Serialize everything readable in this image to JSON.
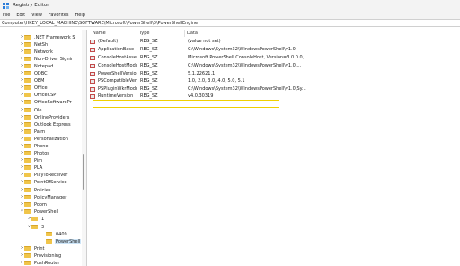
{
  "window": {
    "title": "Registry Editor"
  },
  "menu": [
    "File",
    "Edit",
    "View",
    "Favorites",
    "Help"
  ],
  "address": "Computer\\HKEY_LOCAL_MACHINE\\SOFTWARE\\Microsoft\\PowerShell\\3\\PowerShellEngine",
  "tree": [
    {
      "label": ".NET Framework S",
      "chevron": ">"
    },
    {
      "label": "NetSh",
      "chevron": ">"
    },
    {
      "label": "Network",
      "chevron": ">"
    },
    {
      "label": "Non-Driver Signir",
      "chevron": ">"
    },
    {
      "label": "Notepad",
      "chevron": ">"
    },
    {
      "label": "ODBC",
      "chevron": ">"
    },
    {
      "label": "OEM",
      "chevron": ">"
    },
    {
      "label": "Office",
      "chevron": ">"
    },
    {
      "label": "OfficeCSP",
      "chevron": ">"
    },
    {
      "label": "OfficeSoftwarePr",
      "chevron": ">"
    },
    {
      "label": "Ole",
      "chevron": ">"
    },
    {
      "label": "OnlineProviders",
      "chevron": ">"
    },
    {
      "label": "Outlook Express",
      "chevron": ">"
    },
    {
      "label": "Palm",
      "chevron": ">"
    },
    {
      "label": "Personalization",
      "chevron": ">"
    },
    {
      "label": "Phone",
      "chevron": ">"
    },
    {
      "label": "Photos",
      "chevron": ">"
    },
    {
      "label": "Pim",
      "chevron": ">"
    },
    {
      "label": "PLA",
      "chevron": ">"
    },
    {
      "label": "PlayToReceiver",
      "chevron": ">"
    },
    {
      "label": "PointOfService",
      "chevron": ">"
    },
    {
      "label": "Policies",
      "chevron": ">"
    },
    {
      "label": "PolicyManager",
      "chevron": ">"
    },
    {
      "label": "Poom",
      "chevron": ">"
    },
    {
      "label": "PowerShell",
      "chevron": "v"
    },
    {
      "label": "1",
      "chevron": ">"
    },
    {
      "label": "3",
      "chevron": "v"
    },
    {
      "label": "0409",
      "chevron": ""
    },
    {
      "label": "PowerShell",
      "chevron": ""
    },
    {
      "label": "Print",
      "chevron": ">"
    },
    {
      "label": "Provisioning",
      "chevron": ">"
    },
    {
      "label": "PushRouter",
      "chevron": ">"
    }
  ],
  "columns": {
    "name": "Name",
    "type": "Type",
    "data": "Data"
  },
  "values": [
    {
      "name": "(Default)",
      "type": "REG_SZ",
      "data": "(value not set)"
    },
    {
      "name": "ApplicationBase",
      "type": "REG_SZ",
      "data": "C:\\Windows\\System32\\WindowsPowerShell\\v1.0"
    },
    {
      "name": "ConsoleHostAssembl...",
      "type": "REG_SZ",
      "data": "Microsoft.PowerShell.ConsoleHost, Version=3.0.0.0, ..."
    },
    {
      "name": "ConsoleHostModule...",
      "type": "REG_SZ",
      "data": "C:\\Windows\\System32\\WindowsPowerShell\\v1.0\\..."
    },
    {
      "name": "PowerShellVersion",
      "type": "REG_SZ",
      "data": "5.1.22621.1"
    },
    {
      "name": "PSCompatibleVersion",
      "type": "REG_SZ",
      "data": "1.0, 2.0, 3.0, 4.0, 5.0, 5.1"
    },
    {
      "name": "PSPluginWkrModule...",
      "type": "REG_SZ",
      "data": "C:\\Windows\\System32\\WindowsPowerShell\\v1.0\\Sy..."
    },
    {
      "name": "RuntimeVersion",
      "type": "REG_SZ",
      "data": "v4.0.30319"
    }
  ]
}
